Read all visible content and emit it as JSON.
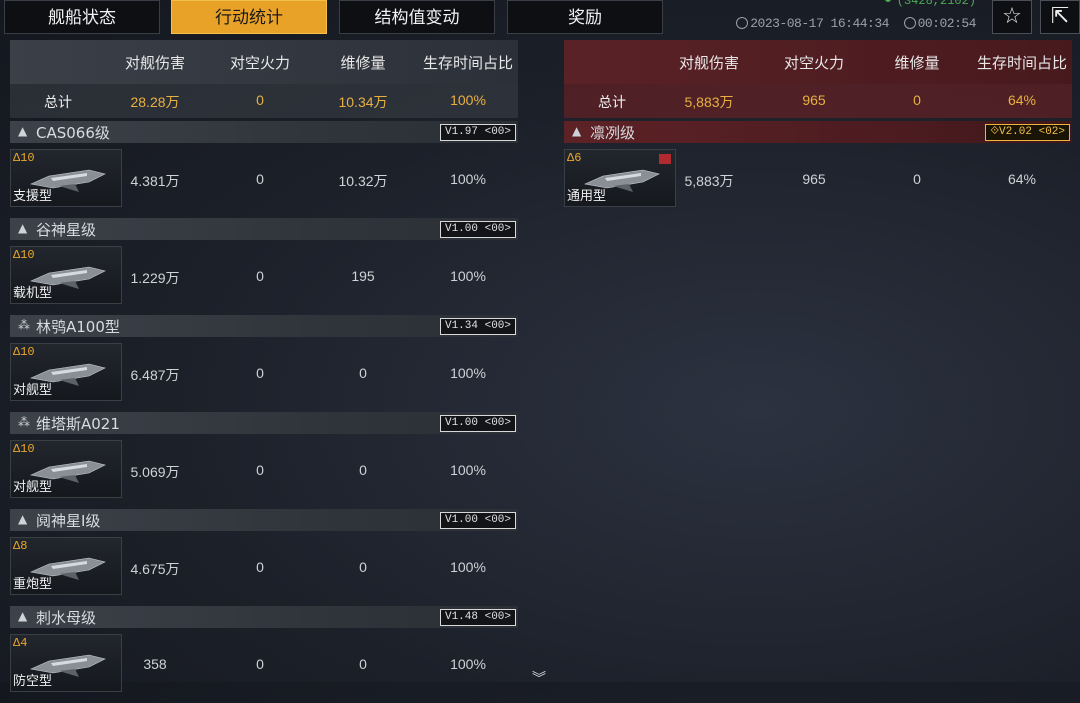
{
  "tabs": [
    {
      "label": "舰船状态"
    },
    {
      "label": "行动统计",
      "active": true
    },
    {
      "label": "结构值变动"
    },
    {
      "label": "奖励"
    }
  ],
  "header": {
    "coordinates": "(3428,2102)",
    "timestamp": "2023-08-17 16:44:34",
    "duration": "00:02:54",
    "icons": [
      "star-icon",
      "share-export-icon"
    ]
  },
  "columns": [
    "对舰伤害",
    "对空火力",
    "维修量",
    "生存时间占比"
  ],
  "left": {
    "total_label": "总计",
    "totals": [
      "28.28万",
      "0",
      "10.34万",
      "100%"
    ],
    "groups": [
      {
        "icon": "▲",
        "name": "CAS066级",
        "version": "V1.97 <00>",
        "level": "Δ10",
        "type": "支援型",
        "values": [
          "4.381万",
          "0",
          "10.32万",
          "100%"
        ]
      },
      {
        "icon": "▲",
        "name": "谷神星级",
        "version": "V1.00 <00>",
        "level": "Δ10",
        "type": "载机型",
        "values": [
          "1.229万",
          "0",
          "195",
          "100%"
        ]
      },
      {
        "icon": "⁂",
        "name": "林鸮A100型",
        "version": "V1.34 <00>",
        "level": "Δ10",
        "type": "对舰型",
        "values": [
          "6.487万",
          "0",
          "0",
          "100%"
        ]
      },
      {
        "icon": "⁂",
        "name": "维塔斯A021",
        "version": "V1.00 <00>",
        "level": "Δ10",
        "type": "对舰型",
        "values": [
          "5.069万",
          "0",
          "0",
          "100%"
        ]
      },
      {
        "icon": "▲",
        "name": "阋神星Ⅰ级",
        "version": "V1.00 <00>",
        "level": "Δ8",
        "type": "重炮型",
        "values": [
          "4.675万",
          "0",
          "0",
          "100%"
        ]
      },
      {
        "icon": "▲",
        "name": "刺水母级",
        "version": "V1.48 <00>",
        "level": "Δ4",
        "type": "防空型",
        "values": [
          "358",
          "0",
          "0",
          "100%"
        ]
      }
    ]
  },
  "right": {
    "total_label": "总计",
    "totals": [
      "5,883万",
      "965",
      "0",
      "64%"
    ],
    "groups": [
      {
        "icon": "▲",
        "name": "凛冽级",
        "version": "⟐V2.02 <02>",
        "level": "Δ6",
        "type": "通用型",
        "values": [
          "5,883万",
          "965",
          "0",
          "64%"
        ]
      }
    ]
  },
  "colors": {
    "accent": "#e8a228",
    "enemy": "#5a2226",
    "value_gold": "#e8b040"
  }
}
